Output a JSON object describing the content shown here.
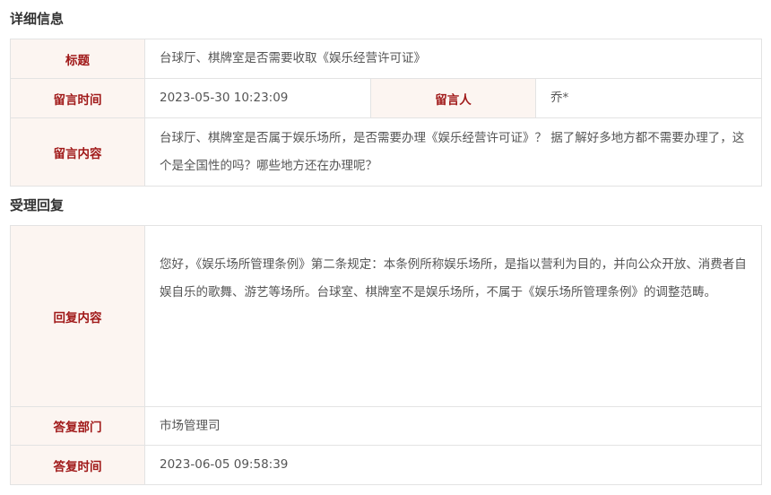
{
  "detail": {
    "section_title": "详细信息",
    "title_label": "标题",
    "title_value": "台球厅、棋牌室是否需要收取《娱乐经营许可证》",
    "time_label": "留言时间",
    "time_value": "2023-05-30 10:23:09",
    "author_label": "留言人",
    "author_value": "乔*",
    "content_label": "留言内容",
    "content_value": "台球厅、棋牌室是否属于娱乐场所，是否需要办理《娱乐经营许可证》？ 据了解好多地方都不需要办理了，这个是全国性的吗？哪些地方还在办理呢？"
  },
  "reply": {
    "section_title": "受理回复",
    "content_label": "回复内容",
    "content_value": "您好，《娱乐场所管理条例》第二条规定：本条例所称娱乐场所，是指以营利为目的，并向公众开放、消费者自娱自乐的歌舞、游艺等场所。台球室、棋牌室不是娱乐场所，不属于《娱乐场所管理条例》的调整范畴。",
    "dept_label": "答复部门",
    "dept_value": "市场管理司",
    "time_label": "答复时间",
    "time_value": "2023-06-05 09:58:39"
  }
}
